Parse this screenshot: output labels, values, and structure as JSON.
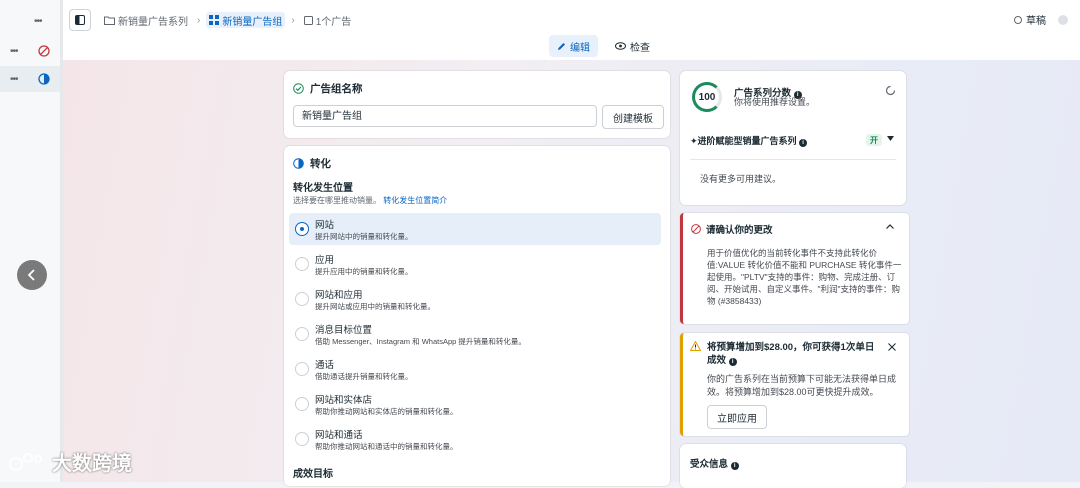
{
  "rail": {
    "more": "•••"
  },
  "breadcrumb": {
    "campaign": "新销量广告系列",
    "adset": "新销量广告组",
    "ad": "1个广告"
  },
  "status": {
    "label": "草稿"
  },
  "modes": {
    "edit": "编辑",
    "review": "检查"
  },
  "adset_name_card": {
    "title": "广告组名称",
    "input_value": "新销量广告组",
    "template_button": "创建模板"
  },
  "conversion_card": {
    "title": "转化",
    "location_label": "转化发生位置",
    "location_hint": "选择要在哪里推动销量。",
    "location_link": "转化发生位置简介",
    "options": [
      {
        "title": "网站",
        "desc": "提升网站中的销量和转化量。",
        "selected": true
      },
      {
        "title": "应用",
        "desc": "提升应用中的销量和转化量。",
        "selected": false
      },
      {
        "title": "网站和应用",
        "desc": "提升网站或应用中的销量和转化量。",
        "selected": false
      },
      {
        "title": "消息目标位置",
        "desc": "借助 Messenger、Instagram 和 WhatsApp 提升销量和转化量。",
        "selected": false
      },
      {
        "title": "通话",
        "desc": "借助通话提升销量和转化量。",
        "selected": false
      },
      {
        "title": "网站和实体店",
        "desc": "帮助你推动网站和实体店的销量和转化量。",
        "selected": false
      },
      {
        "title": "网站和通话",
        "desc": "帮助你推动网站和通话中的销量和转化量。",
        "selected": false
      }
    ],
    "goal_label": "成效目标"
  },
  "score_card": {
    "score": "100",
    "title": "广告系列分数",
    "subtitle": "你将使用推荐设置。",
    "advantage_label": "进阶赋能型销量广告系列",
    "advantage_state": "开",
    "no_suggestions": "没有更多可用建议。"
  },
  "confirm_card": {
    "title": "请确认你的更改",
    "body": "用于价值优化的当前转化事件不支持此转化价值:VALUE 转化价值不能和 PURCHASE 转化事件一起使用。\"PLTV\"支持的事件：购物、完成注册、订阅、开始试用、自定义事件。\"利润\"支持的事件：购物 (#3858433)"
  },
  "budget_card": {
    "title": "将预算增加到$28.00，你可获得1次单日成效",
    "body": "你的广告系列在当前预算下可能无法获得单日成效。将预算增加到$28.00可更快提升成效。",
    "apply_button": "立即应用"
  },
  "audience_card": {
    "title": "受众信息"
  },
  "watermark": {
    "text": "大数跨境"
  },
  "colors": {
    "accent": "#0a66c2",
    "score": "#1c8a5a",
    "error": "#c4363f",
    "warning": "#e0a100"
  }
}
